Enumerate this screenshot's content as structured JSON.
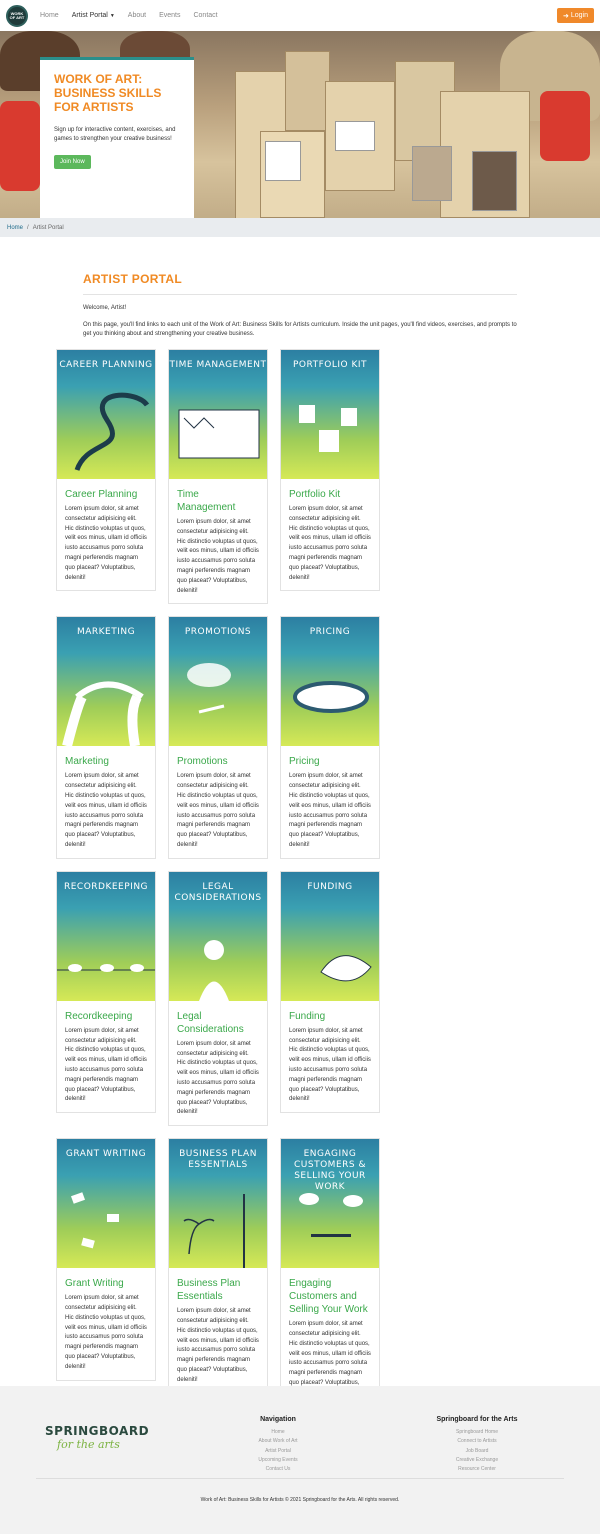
{
  "nav": {
    "logo_text": "WORK OF ART",
    "links": [
      "Home",
      "Artist Portal",
      "About",
      "Events",
      "Contact"
    ],
    "login": "Login"
  },
  "hero": {
    "title": "WORK OF ART: BUSINESS SKILLS FOR ARTISTS",
    "text": "Sign up for interactive content, exercises, and games to strengthen your creative business!",
    "button": "Join Now"
  },
  "breadcrumb": {
    "home": "Home",
    "separator": "/",
    "current": "Artist Portal"
  },
  "portal": {
    "heading": "ARTIST PORTAL",
    "welcome": "Welcome, Artist!",
    "intro": "On this page, you'll find links to each unit of the Work of Art: Business Skills for Artists curriculum. Inside the unit pages, you'll find videos, exercises, and prompts to get you thinking about and strengthening your creative business."
  },
  "lorem": "Lorem ipsum dolor, sit amet consectetur adipisicing elit. Hic distinctio voluptas ut quos, velit eos minus, ullam id officiis iusto accusamus porro soluta magni perferendis magnam quo placeat? Voluptatibus, deleniti!",
  "units": [
    {
      "title": "Career Planning",
      "art": "CAREER PLANNING"
    },
    {
      "title": "Time Management",
      "art": "TIME MANAGEMENT"
    },
    {
      "title": "Portfolio Kit",
      "art": "PORTFOLIO KIT"
    },
    {
      "title": "Marketing",
      "art": "MARKETING"
    },
    {
      "title": "Promotions",
      "art": "PROMOTIONS"
    },
    {
      "title": "Pricing",
      "art": "PRICING"
    },
    {
      "title": "Recordkeeping",
      "art": "RECORDKEEPING"
    },
    {
      "title": "Legal Considerations",
      "art": "LEGAL CONSIDERATIONS"
    },
    {
      "title": "Funding",
      "art": "FUNDING"
    },
    {
      "title": "Grant Writing",
      "art": "GRANT WRITING"
    },
    {
      "title": "Business Plan Essentials",
      "art": "BUSINESS PLAN ESSENTIALS"
    },
    {
      "title": "Engaging Customers and Selling Your Work",
      "art": "ENGAGING CUSTOMERS & SELLING YOUR WORK"
    }
  ],
  "footer": {
    "logo_line1": "SPRINGBOARD",
    "logo_line2": "for the arts",
    "nav_heading": "Navigation",
    "nav_links": [
      "Home",
      "About Work of Art",
      "Artist Portal",
      "Upcoming Events",
      "Contact Us"
    ],
    "sb_heading": "Springboard for the Arts",
    "sb_links": [
      "Springboard Home",
      "Connect to Artists",
      "Job Board",
      "Creative Exchange",
      "Resource Center"
    ],
    "copyright": "Work of Art: Business Skills for Artists © 2021 Springboard for the Arts. All rights reserved."
  },
  "colors": {
    "accent": "#f08a24",
    "green": "#3aa84a",
    "teal": "#2b8f8b"
  }
}
